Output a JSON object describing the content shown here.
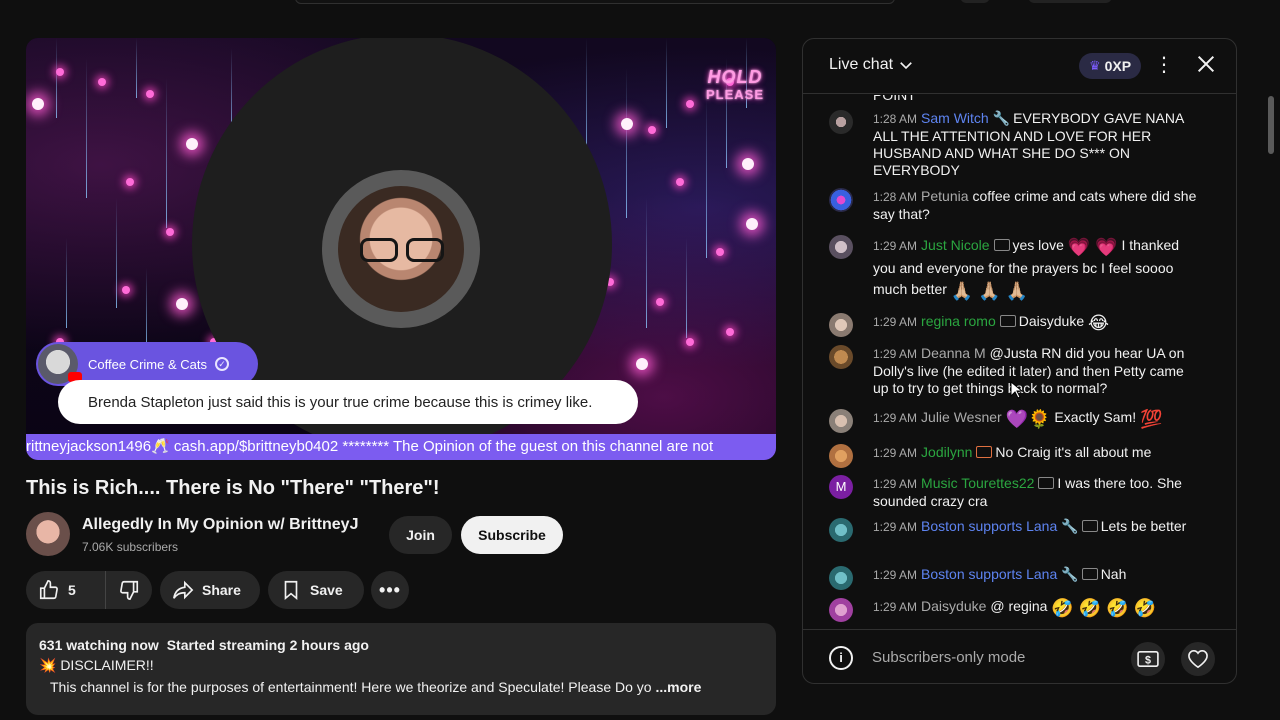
{
  "player": {
    "hold_line1": "HOLD",
    "hold_line2": "PLEASE",
    "channel_pill": "Coffee Crime & Cats",
    "quote": "Brenda Stapleton just said this is your true crime because this is crimey like.",
    "ticker": "rittneyjackson1496🥂 cash.app/$brittneyb0402 ******** The Opinion of the guest on this channel are not"
  },
  "video": {
    "title": "This is Rich.... There is No \"There\" \"There\"!",
    "channel_name": "Allegedly In My Opinion w/ BrittneyJ",
    "subscribers": "7.06K subscribers",
    "join_label": "Join",
    "subscribe_label": "Subscribe"
  },
  "actions": {
    "like_count": "5",
    "share_label": "Share",
    "save_label": "Save"
  },
  "description": {
    "watching": "631 watching now",
    "started": "Started streaming 2 hours ago",
    "line2": "💥 DISCLAIMER!!",
    "line3": "This channel is for the purposes of entertainment!  Here we theorize and Speculate!  Please Do yo",
    "more": "...more"
  },
  "chat": {
    "title": "Live chat",
    "xp": "0XP",
    "cut_text": "POINT",
    "messages": [
      {
        "time": "1:28 AM",
        "author": "Sam Witch",
        "text": "EVERYBODY GAVE NANA ALL THE ATTENTION AND LOVE FOR HER HUSBAND AND WHAT SHE DO S*** ON EVERYBODY"
      },
      {
        "time": "1:28 AM",
        "author": "Petunia",
        "text": "coffee crime and cats where did she say that?"
      },
      {
        "time": "1:29 AM",
        "author": "Just Nicole",
        "text_a": "yes love",
        "emo_a": "💗 💗",
        "text_b": "I thanked you and everyone for the prayers bc I feel soooo much better",
        "emo_b": "🙏🏼 🙏🏼 🙏🏼"
      },
      {
        "time": "1:29 AM",
        "author": "regina romo",
        "text": "Daisyduke",
        "emo": "😂"
      },
      {
        "time": "1:29 AM",
        "author": "Deanna M",
        "text": "@Justa RN did you hear UA on Dolly's live (he edited it later) and then Petty came up to try to get things back to normal?"
      },
      {
        "time": "1:29 AM",
        "author": "Julie Wesner",
        "emo_a": "💜🌻",
        "text": "Exactly Sam!",
        "emo": "💯"
      },
      {
        "time": "1:29 AM",
        "author": "Jodilynn",
        "text": "No Craig it's all about me"
      },
      {
        "time": "1:29 AM",
        "author": "Music Tourettes22",
        "text": "I was there too. She sounded crazy cra",
        "avatar_letter": "M"
      },
      {
        "time": "1:29 AM",
        "author": "Boston supports Lana",
        "text": "Lets be better"
      },
      {
        "time": "1:29 AM",
        "author": "Boston supports Lana",
        "text": "Nah"
      },
      {
        "time": "1:29 AM",
        "author": "Daisyduke",
        "text": "@ regina",
        "emo": "🤣 🤣 🤣 🤣"
      }
    ],
    "footer": "Subscribers-only mode"
  },
  "colors": {
    "background": "#0f0f0f",
    "chip": "#272727",
    "author_blue": "#5e84f1",
    "author_green": "#2ba640",
    "pill": "#6a54e0",
    "ticker": "#7c5cf0"
  },
  "icons": [
    "like-icon",
    "dislike-icon",
    "share-icon",
    "save-icon",
    "more-icon",
    "chevron-down-icon",
    "crown-icon",
    "kebab-icon",
    "close-icon",
    "info-icon",
    "dollar-icon",
    "heart-icon",
    "wrench-icon",
    "verified-icon"
  ]
}
